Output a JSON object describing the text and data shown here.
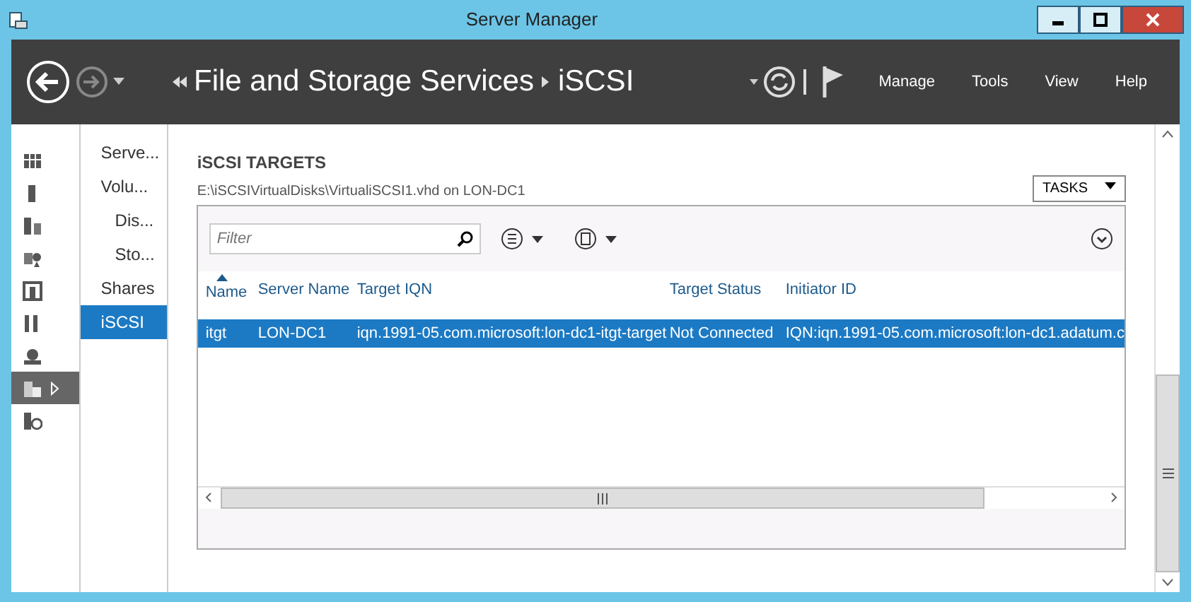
{
  "window": {
    "title": "Server Manager"
  },
  "header": {
    "breadcrumb": [
      {
        "label": "File and Storage Services"
      },
      {
        "label": "iSCSI"
      }
    ],
    "menu": [
      {
        "label": "Manage"
      },
      {
        "label": "Tools"
      },
      {
        "label": "View"
      },
      {
        "label": "Help"
      }
    ]
  },
  "rail": [
    {
      "selected": false
    },
    {
      "selected": false
    },
    {
      "selected": false
    },
    {
      "selected": false
    },
    {
      "selected": false
    },
    {
      "selected": false
    },
    {
      "selected": false
    },
    {
      "selected": true
    },
    {
      "selected": false
    }
  ],
  "nav": [
    {
      "label": "Serve...",
      "selected": false
    },
    {
      "label": "Volu...",
      "selected": false,
      "children": [
        {
          "label": "Dis...",
          "selected": false
        },
        {
          "label": "Sto...",
          "selected": false
        }
      ]
    },
    {
      "label": "Shares",
      "selected": false
    },
    {
      "label": "iSCSI",
      "selected": true
    }
  ],
  "section": {
    "title": "iSCSI TARGETS",
    "subtitle": "E:\\iSCSIVirtualDisks\\VirtualiSCSI1.vhd on LON-DC1",
    "tasks": "TASKS"
  },
  "filter": {
    "placeholder": "Filter"
  },
  "table": {
    "columns": [
      "Name",
      "Server Name",
      "Target IQN",
      "Target Status",
      "Initiator ID"
    ],
    "rows": [
      {
        "selected": true,
        "cells": [
          "itgt",
          "LON-DC1",
          "iqn.1991-05.com.microsoft:lon-dc1-itgt-target",
          "Not Connected",
          "IQN:iqn.1991-05.com.microsoft:lon-dc1.adatum.c"
        ]
      }
    ]
  }
}
